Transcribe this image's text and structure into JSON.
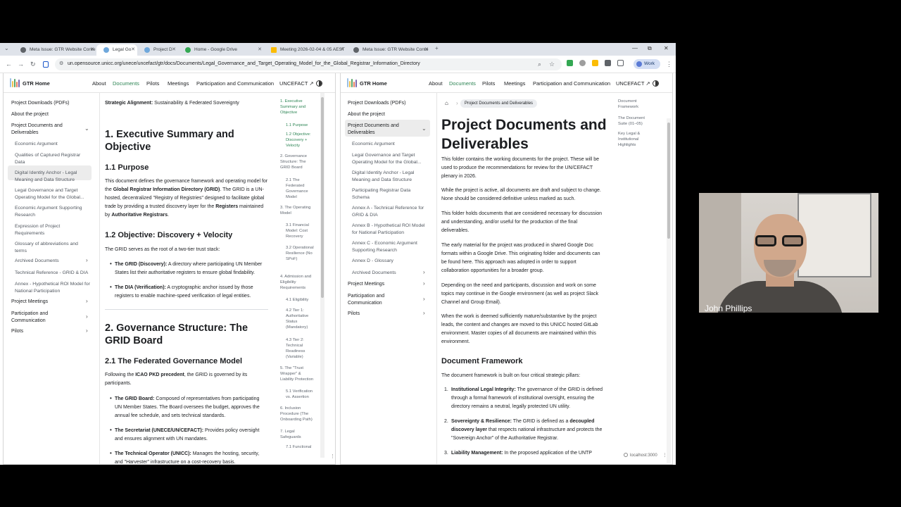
{
  "browser": {
    "tabs": [
      {
        "label": "Meta Issue: GTR Website Conte",
        "color": "#5f6368"
      },
      {
        "label": "Legal Go",
        "color": "#6fa8dc"
      },
      {
        "label": "Project D",
        "color": "#6fa8dc"
      },
      {
        "label": "Home - Google Drive",
        "color": "#34a853"
      },
      {
        "label": "Meeting 2026-02-04 & 05 AEST",
        "color": "#fbbc04"
      },
      {
        "label": "Meta Issue: GTR Website Conte",
        "color": "#5f6368"
      }
    ],
    "tab_list_icon": "chevron-down",
    "new_tab_icon": "+",
    "url": "un.opensource.unicc.org/unece/uncefact/gtr/docs/Documents/Legal_Governance_and_Target_Operating_Model_for_the_Global_Registrar_Information_Directory",
    "profile": "Work",
    "extension_colors": [
      "#34a853",
      "#9e9e9e",
      "#5f6368",
      "#fbbc04",
      "#5f6368",
      "#5f6368"
    ]
  },
  "site": {
    "brand": "GTR Home",
    "nav": {
      "about": "About",
      "documents": "Documents",
      "pilots": "Pilots",
      "meetings": "Meetings",
      "participation": "Participation and Communication",
      "uncefact": "UNCEFACT ↗"
    },
    "logo_colors": [
      "#9bc1e4",
      "#f2c14e",
      "#5aa469",
      "#e57a5b",
      "#7b68ae",
      "#4aa3a2"
    ]
  },
  "left": {
    "sidebar": [
      {
        "label": "Project Downloads (PDFs)"
      },
      {
        "label": "About the project"
      },
      {
        "label": "Project Documents and Deliverables"
      },
      {
        "label": "Economic Argument"
      },
      {
        "label": "Qualities of Captured Registrar Data"
      },
      {
        "label": "Digital Identity Anchor - Legal Meaning and Data Structure"
      },
      {
        "label": "Legal Governance and Target Operating Model for the Global..."
      },
      {
        "label": "Economic Argument Supporting Research"
      },
      {
        "label": "Expression of Project Requirements"
      },
      {
        "label": "Glossary of abbreviations and terms"
      },
      {
        "label": "Archived Documents"
      },
      {
        "label": "Technical Reference - GRID & DIA"
      },
      {
        "label": "Annex - Hypothetical ROI Model for National Participation"
      },
      {
        "label": "Project Meetings"
      },
      {
        "label": "Participation and Communication"
      },
      {
        "label": "Pilots"
      }
    ],
    "doc": {
      "alignment_label": "Strategic Alignment:",
      "alignment_text": " Sustainability & Federated Sovereignty",
      "h1": "1. Executive Summary and Objective",
      "h_purpose": "1.1 Purpose",
      "purpose_1": "This document defines the governance framework and operating model for the ",
      "purpose_bold1": "Global Registrar Information Directory (GRID)",
      "purpose_2": ". The GRID is a UN-hosted, decentralized \"Registry of Registries\" designed to facilitate global trade by providing a trusted discovery layer for the ",
      "purpose_bold2": "Registers",
      "purpose_3": " maintained by ",
      "purpose_bold3": "Authoritative Registrars",
      "purpose_4": ".",
      "h_objective": "1.2 Objective: Discovery + Velocity",
      "objective_intro": "The GRID serves as the root of a two-tier trust stack:",
      "tier1_label": "The GRID (Discovery):",
      "tier1_text": " A directory where participating UN Member States list their authoritative registers to ensure global findability.",
      "tier2_label": "The DIA (Verification):",
      "tier2_text": " A cryptographic anchor issued by those registers to enable machine-speed verification of legal entities.",
      "h2": "2. Governance Structure: The GRID Board",
      "h_federated": "2.1 The Federated Governance Model",
      "fed_1": "Following the ",
      "fed_bold": "ICAO PKD precedent",
      "fed_2": ", the GRID is governed by its participants.",
      "board_label": "The GRID Board:",
      "board_text": " Composed of representatives from participating UN Member States. The Board oversees the budget, approves the annual fee schedule, and sets technical standards.",
      "sec_label": "The Secretariat (UNECE/UN/CEFACT):",
      "sec_text": " Provides policy oversight and ensures alignment with UN mandates.",
      "op_label": "The Technical Operator (UNICC):",
      "op_text": " Manages the hosting, security, and \"Harvester\" infrastructure on a cost-recovery basis."
    },
    "toc": [
      "1. Executive Summary and Objective",
      "1.1 Purpose",
      "1.2 Objective: Discovery + Velocity",
      "2. Governance Structure: The GRID Board",
      "2.1 The Federated Governance Model",
      "3. The Operating Model",
      "3.1 Financial Model: Cost Recovery",
      "3.2 Operational Resilience (No SPoF)",
      "4. Admission and Eligibility Requirements",
      "4.1 Eligibility",
      "4.2 Tier 1: Authoritative Status (Mandatory)",
      "4.3 Tier 2: Technical Readiness (Variable)",
      "5. The \"Trust Wrapper\" & Liability Protection",
      "5.1 Verification vs. Assertion",
      "6. Inclusion Procedure (The Onboarding Path)",
      "7. Legal Safeguards",
      "7.1 Functional"
    ]
  },
  "right": {
    "sidebar": [
      {
        "label": "Project Downloads (PDFs)"
      },
      {
        "label": "About the project"
      },
      {
        "label": "Project Documents and Deliverables"
      },
      {
        "label": "Economic Argument"
      },
      {
        "label": "Legal Governance and Target Operating Model for the Global..."
      },
      {
        "label": "Digital Identity Anchor - Legal Meaning and Data Structure"
      },
      {
        "label": "Participating Registrar Data Schema"
      },
      {
        "label": "Annex A - Technical Reference for GRID & DIA"
      },
      {
        "label": "Annex B - Hypothetical ROI Model for National Participation"
      },
      {
        "label": "Annex C - Economic Argument Supporting Research"
      },
      {
        "label": "Annex D - Glossary"
      },
      {
        "label": "Archived Documents"
      },
      {
        "label": "Project Meetings"
      },
      {
        "label": "Participation and Communication"
      },
      {
        "label": "Pilots"
      }
    ],
    "breadcrumb": "Project Documents and Deliverables",
    "doc": {
      "title": "Project Documents and Deliverables",
      "p1": "This folder contains the working documents for the project. These will be used to produce the recommendations for review for the UN/CEFACT plenary in 2026.",
      "p2": "While the project is active, all documents are draft and subject to change. None should be considered definitive unless marked as such.",
      "p3": "This folder holds documents that are considered necessary for discussion and understanding, and/or useful for the production of the final deliverables.",
      "p4": "The early material for the project was produced in shared Google Doc formats within a Google Drive. This originating folder and documents can be found here. This approach was adopted in order to support collaboration opportunities for a broader group.",
      "p5": "Depending on the need and participants, discussion and work on some topics may continue in the Google environment (as well as project Slack Channel and Group Email).",
      "p6": "When the work is deemed sufficiently mature/substantive by the project leads, the content and changes are moved to this UNICC hosted GitLab environment. Master copies of all documents are maintained within this environment.",
      "h_framework": "Document Framework",
      "framework_intro": "The document framework is built on four critical strategic pillars:",
      "pillar1_label": "Institutional Legal Integrity:",
      "pillar1_text": " The governance of the GRID is defined through a formal framework of institutional oversight, ensuring the directory remains a neutral, legally protected UN utility.",
      "pillar2_label": "Sovereignty & Resilience:",
      "pillar2_text_a": " The GRID is defined as a ",
      "pillar2_bold": "decoupled discovery layer",
      "pillar2_text_b": " that respects national infrastructure and protects the \"Sovereign Anchor\" of the Authoritative Registrar.",
      "pillar3_label": "Liability Management:",
      "pillar3_text": " In the proposed application of the UNTP"
    },
    "toc": [
      "Document Framework",
      "The Document Suite (01–05)",
      "Key Legal & Institutional Highlights"
    ]
  },
  "status": {
    "localhost": "localhost:3000"
  },
  "webcam": {
    "name": "John Phillips"
  }
}
